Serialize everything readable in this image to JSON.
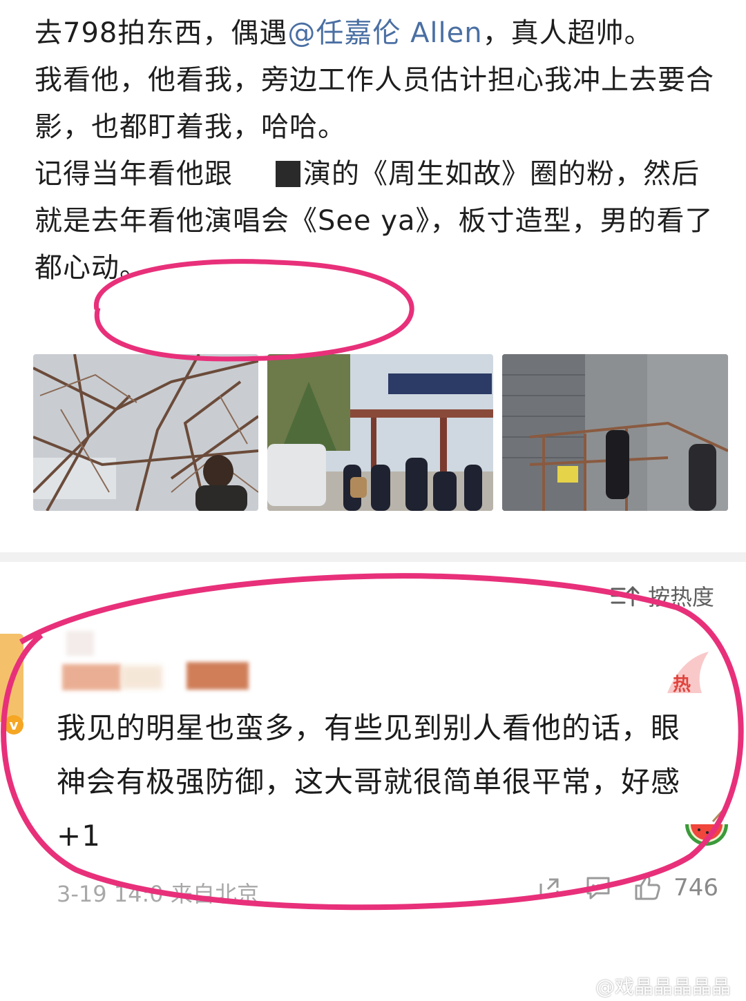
{
  "post": {
    "line1_pre": "去798拍东西，偶遇",
    "mention": "@任嘉伦 Allen",
    "line1_post": "，真人超帅。",
    "line2": "我看他，他看我，旁边工作人员估计担心我冲上去要合影，也都盯着我，哈哈。",
    "line3_pre": "记得当年看他跟",
    "line3_post": "演的《周生如故》圈的粉，然后就是去年看他演唱会《See ya》，板寸造型，男的看了都心动。",
    "photos": [
      {
        "icon": "tree-branches-photo"
      },
      {
        "icon": "street-crowd-photo"
      },
      {
        "icon": "staircase-building-photo"
      }
    ]
  },
  "comments": {
    "sort_label": "按热度",
    "sort_icon": "sort-hot-icon",
    "top_comment": {
      "text": "我见的明星也蛮多，有些见到别人看他的话，眼神会有极强防御，这大哥就很简单很平常，好感 +1",
      "verify_mark": "v",
      "date": "3-19",
      "time_partial": "14:0",
      "location": "来自北京",
      "likes": "746"
    }
  },
  "watermark": "@戏晶晶晶晶晶",
  "colors": {
    "mention": "#4a6fa3",
    "highlight_circle": "#e8307a"
  }
}
